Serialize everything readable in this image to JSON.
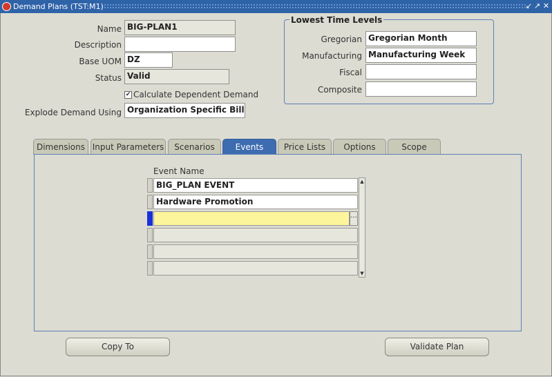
{
  "window": {
    "title": "Demand Plans (TST:M1)",
    "controls": [
      "↙",
      "↗",
      "✕"
    ]
  },
  "form": {
    "name": {
      "label": "Name",
      "value": "BIG-PLAN1"
    },
    "description": {
      "label": "Description",
      "value": ""
    },
    "base_uom": {
      "label": "Base UOM",
      "value": "DZ"
    },
    "status": {
      "label": "Status",
      "value": "Valid"
    },
    "calc_dependent": {
      "label": "Calculate Dependent Demand",
      "checked": true
    },
    "explode_using": {
      "label": "Explode Demand Using",
      "value": "Organization Specific Bill of"
    }
  },
  "time_levels": {
    "title": "Lowest Time Levels",
    "gregorian": {
      "label": "Gregorian",
      "value": "Gregorian Month"
    },
    "manufacturing": {
      "label": "Manufacturing",
      "value": "Manufacturing Week"
    },
    "fiscal": {
      "label": "Fiscal",
      "value": ""
    },
    "composite": {
      "label": "Composite",
      "value": ""
    }
  },
  "tabs": [
    {
      "label": "Dimensions"
    },
    {
      "label": "Input Parameters"
    },
    {
      "label": "Scenarios"
    },
    {
      "label": "Events",
      "active": true
    },
    {
      "label": "Price Lists"
    },
    {
      "label": "Options"
    },
    {
      "label": "Scope"
    }
  ],
  "events": {
    "column_header": "Event Name",
    "rows": [
      "BIG_PLAN EVENT",
      "Hardware Promotion",
      "",
      "",
      "",
      ""
    ],
    "lov_icon": "ellipsis-icon"
  },
  "buttons": {
    "copy_to": "Copy To",
    "validate_plan": "Validate Plan"
  }
}
